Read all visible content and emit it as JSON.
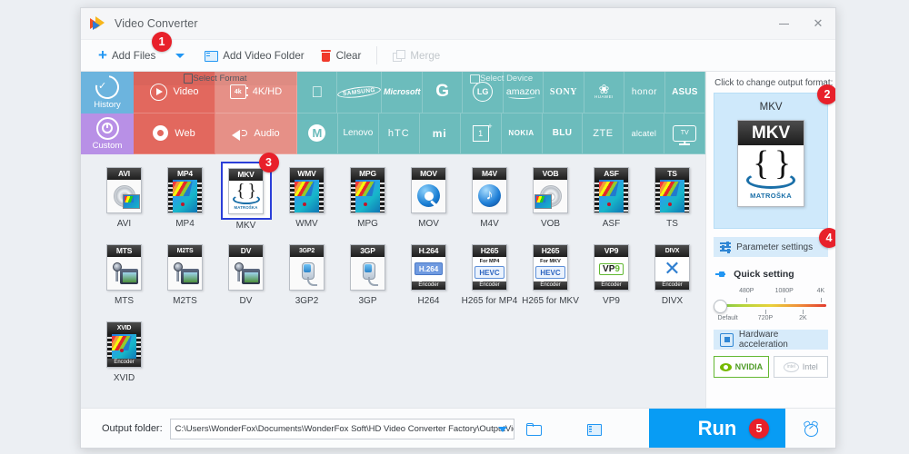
{
  "window": {
    "title": "Video Converter",
    "logo_icon": "app-logo-icon",
    "minimize_label": "",
    "close_label": "✕"
  },
  "toolbar": {
    "add_files": "Add Files",
    "add_video_folder": "Add Video Folder",
    "clear": "Clear",
    "merge": "Merge"
  },
  "badges": {
    "one": "1",
    "two": "2",
    "three": "3",
    "four": "4",
    "five": "5"
  },
  "sidebar": {
    "history": "History",
    "custom": "Custom"
  },
  "category": {
    "format_header": "Select Format",
    "device_header": "Select Device",
    "format_tiles": [
      {
        "label": "Video",
        "icon": "play-circle-icon",
        "shade": "dark"
      },
      {
        "label": "4K/HD",
        "icon": "4k-icon",
        "shade": "light"
      },
      {
        "label": "Web",
        "icon": "chrome-icon",
        "shade": "dark"
      },
      {
        "label": "Audio",
        "icon": "speaker-icon",
        "shade": "light"
      }
    ],
    "device_row1": [
      "Apple",
      "SAMSUNG",
      "Microsoft",
      "G",
      "LG",
      "amazon",
      "SONY",
      "HUAWEI",
      "honor",
      "ASUS"
    ],
    "device_row2": [
      "Motorola",
      "Lenovo",
      "hTC",
      "mi",
      "1+",
      "NOKIA",
      "BLU",
      "ZTE",
      "alcatel",
      "TV"
    ]
  },
  "formats": [
    {
      "name": "AVI",
      "badge": "AVI",
      "art": "disc-film",
      "selected": false
    },
    {
      "name": "MP4",
      "badge": "MP4",
      "art": "video",
      "selected": false
    },
    {
      "name": "MKV",
      "badge": "MKV",
      "art": "matroska",
      "selected": true,
      "sub": "MATROŠKA"
    },
    {
      "name": "WMV",
      "badge": "WMV",
      "art": "video",
      "selected": false
    },
    {
      "name": "MPG",
      "badge": "MPG",
      "art": "video",
      "selected": false
    },
    {
      "name": "MOV",
      "badge": "MOV",
      "art": "quicktime",
      "selected": false
    },
    {
      "name": "M4V",
      "badge": "M4V",
      "art": "itunes",
      "selected": false
    },
    {
      "name": "VOB",
      "badge": "VOB",
      "art": "disc-film",
      "selected": false
    },
    {
      "name": "ASF",
      "badge": "ASF",
      "art": "video",
      "selected": false
    },
    {
      "name": "TS",
      "badge": "TS",
      "art": "video",
      "selected": false
    },
    {
      "name": "MTS",
      "badge": "MTS",
      "art": "camcorder",
      "selected": false
    },
    {
      "name": "M2TS",
      "badge": "M2TS",
      "art": "camcorder",
      "selected": false
    },
    {
      "name": "DV",
      "badge": "DV",
      "art": "camcorder",
      "selected": false
    },
    {
      "name": "3GP2",
      "badge": "3GP2",
      "art": "phone",
      "selected": false
    },
    {
      "name": "3GP",
      "badge": "3GP",
      "art": "phone",
      "selected": false
    },
    {
      "name": "H264",
      "badge": "H.264",
      "art": "codec-h264",
      "selected": false,
      "chip": "H.264",
      "foot": "Encoder"
    },
    {
      "name": "H265 for MP4",
      "badge": "H265",
      "art": "codec-hevc",
      "selected": false,
      "sub": "For MP4",
      "chip": "HEVC",
      "foot": "Encoder"
    },
    {
      "name": "H265 for MKV",
      "badge": "H265",
      "art": "codec-hevc",
      "selected": false,
      "sub": "For MKV",
      "chip": "HEVC",
      "foot": "Encoder"
    },
    {
      "name": "VP9",
      "badge": "VP9",
      "art": "codec-vp9",
      "selected": false,
      "chip": "VP9",
      "foot": "Encoder"
    },
    {
      "name": "DIVX",
      "badge": "DIVX",
      "art": "codec-divx",
      "selected": false,
      "foot": "Encoder"
    },
    {
      "name": "XVID",
      "badge": "XVID",
      "art": "video",
      "selected": false,
      "foot": "Encoder"
    }
  ],
  "right_panel": {
    "hint": "Click to change output format:",
    "output_format": "MKV",
    "thumb_badge": "MKV",
    "thumb_sub": "MATROŠKA",
    "parameter_settings": "Parameter settings",
    "quick_setting": "Quick setting",
    "slider": {
      "top_labels": [
        "480P",
        "1080P",
        "4K"
      ],
      "bottom_labels": [
        "Default",
        "720P",
        "2K"
      ],
      "value": "Default"
    },
    "hardware_acceleration": "Hardware acceleration",
    "nvidia": "NVIDIA",
    "intel": "Intel"
  },
  "bottom": {
    "output_folder_label": "Output folder:",
    "output_folder_path": "C:\\Users\\WonderFox\\Documents\\WonderFox Soft\\HD Video Converter Factory\\OutputVideo\\",
    "open_folder_icon": "open-folder-icon",
    "film_folder_icon": "film-folder-icon",
    "run_label": "Run",
    "alarm_icon": "alarm-clock-icon"
  },
  "colors": {
    "accent": "#089cf4",
    "badge_red": "#e8202a",
    "format_dark": "#e2685e",
    "format_light": "#e69087",
    "device_teal": "#6cbcbc",
    "history_blue": "#6cb4de",
    "custom_purple": "#b890e6",
    "selected_border": "#2b3fd8"
  }
}
